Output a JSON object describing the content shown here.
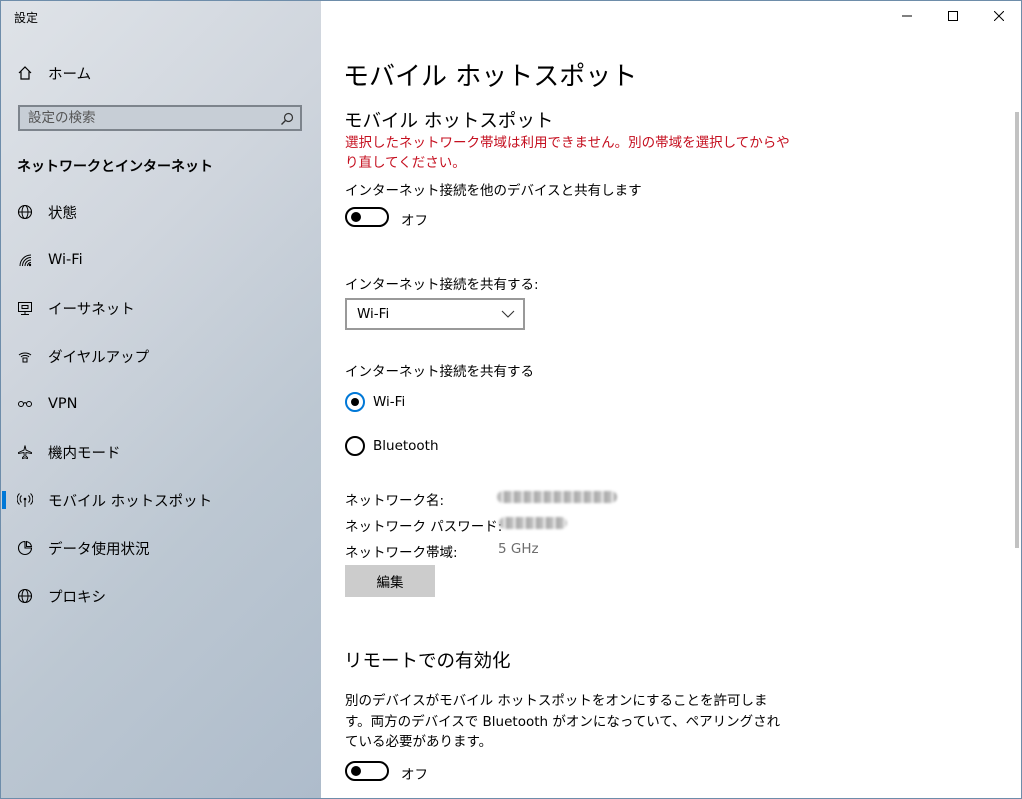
{
  "window": {
    "title": "設定"
  },
  "sidebar": {
    "home_label": "ホーム",
    "search_placeholder": "設定の検索",
    "section_title": "ネットワークとインターネット",
    "items": [
      {
        "label": "状態",
        "icon": "globe-status-icon"
      },
      {
        "label": "Wi-Fi",
        "icon": "wifi-icon"
      },
      {
        "label": "イーサネット",
        "icon": "ethernet-icon"
      },
      {
        "label": "ダイヤルアップ",
        "icon": "dialup-icon"
      },
      {
        "label": "VPN",
        "icon": "vpn-icon"
      },
      {
        "label": "機内モード",
        "icon": "airplane-icon"
      },
      {
        "label": "モバイル ホットスポット",
        "icon": "hotspot-icon",
        "active": true
      },
      {
        "label": "データ使用状況",
        "icon": "data-usage-icon"
      },
      {
        "label": "プロキシ",
        "icon": "globe-icon"
      }
    ]
  },
  "main": {
    "page_title": "モバイル ホットスポット",
    "section1_title": "モバイル ホットスポット",
    "error": "選択したネットワーク帯域は利用できません。別の帯域を選択してからやり直してください。",
    "share_desc": "インターネット接続を他のデバイスと共有します",
    "toggle1_label": "オフ",
    "share_from_label": "インターネット接続を共有する:",
    "share_from_value": "Wi-Fi",
    "share_over_label": "インターネット接続を共有する",
    "radio_wifi": "Wi-Fi",
    "radio_bluetooth": "Bluetooth",
    "network_name_label": "ネットワーク名:",
    "network_password_label": "ネットワーク パスワード:",
    "network_band_label": "ネットワーク帯域:",
    "network_band_value": "5 GHz",
    "edit_button": "編集",
    "section2_title": "リモートでの有効化",
    "remote_desc": "別のデバイスがモバイル ホットスポットをオンにすることを許可します。両方のデバイスで Bluetooth がオンになっていて、ペアリングされている必要があります。",
    "toggle2_label": "オフ"
  },
  "colors": {
    "accent": "#0078d7",
    "error": "#c50f1f"
  }
}
